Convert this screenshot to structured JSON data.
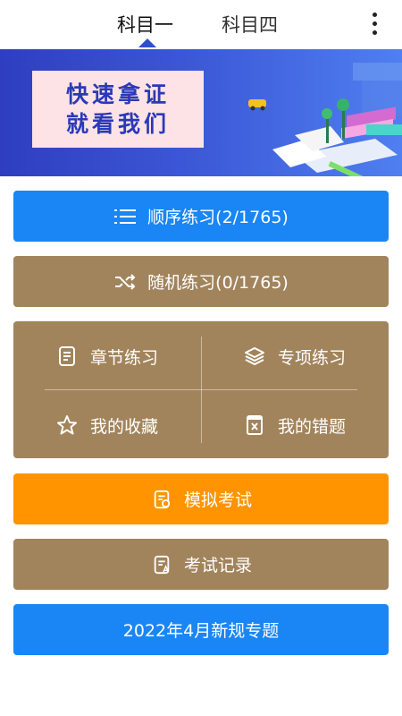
{
  "tabs": [
    {
      "label": "科目一",
      "active": true
    },
    {
      "label": "科目四",
      "active": false
    }
  ],
  "banner": {
    "line1": "快速拿证",
    "line2": "就看我们"
  },
  "buttons": {
    "sequential": "顺序练习(2/1765)",
    "random": "随机练习(0/1765)",
    "mock_exam": "模拟考试",
    "exam_records": "考试记录",
    "new_rules": "2022年4月新规专题"
  },
  "grid": {
    "chapter": "章节练习",
    "special": "专项练习",
    "favorites": "我的收藏",
    "mistakes": "我的错题"
  },
  "colors": {
    "blue": "#1a86f5",
    "brown": "#a2845c",
    "orange": "#ff9400",
    "indicator": "#2e4fcf"
  },
  "icons": {
    "more": "more-vertical-icon",
    "sequential": "list-icon",
    "random": "shuffle-icon",
    "chapter": "document-icon",
    "special": "layers-icon",
    "favorites": "star-icon",
    "mistakes": "error-book-icon",
    "mock_exam": "exam-paper-icon",
    "exam_records": "record-icon"
  }
}
